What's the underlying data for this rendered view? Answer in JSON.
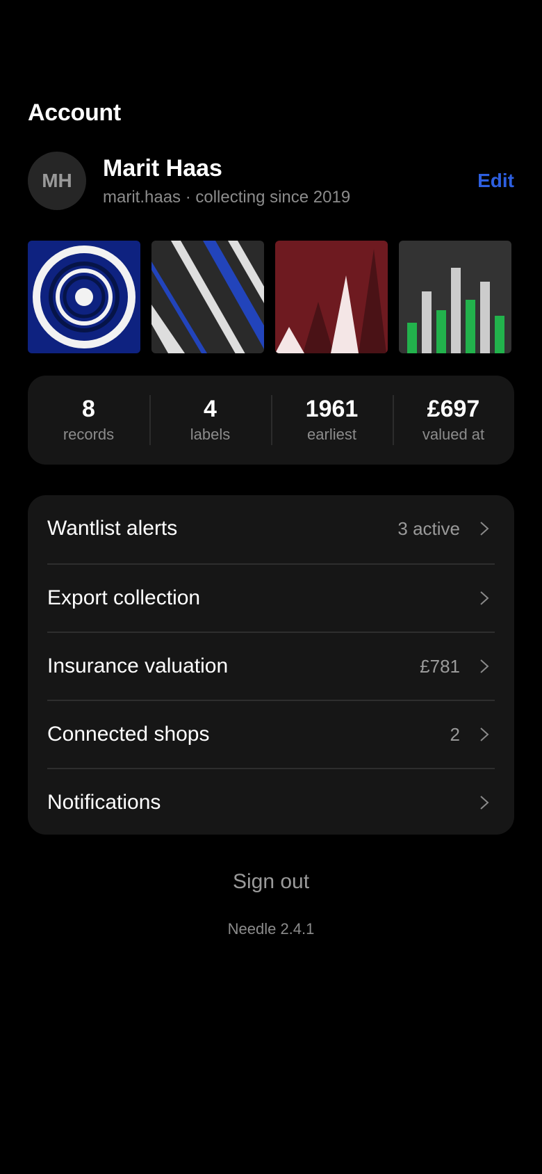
{
  "page": {
    "title": "Account"
  },
  "profile": {
    "initials": "MH",
    "name": "Marit Haas",
    "subtitle": "marit.haas · collecting since 2019",
    "edit_label": "Edit"
  },
  "colors": {
    "accent": "#2d5fe0",
    "background": "#000000",
    "card": "#161616"
  },
  "thumbnails": [
    {
      "name": "blue-rings-cover"
    },
    {
      "name": "diagonal-stripes-cover"
    },
    {
      "name": "red-peaks-cover"
    },
    {
      "name": "bars-cover"
    }
  ],
  "stats": [
    {
      "value": "8",
      "label": "records"
    },
    {
      "value": "4",
      "label": "labels"
    },
    {
      "value": "1961",
      "label": "earliest"
    },
    {
      "value": "£697",
      "label": "valued at"
    }
  ],
  "menu": [
    {
      "label": "Wantlist alerts",
      "value": "3 active",
      "icon": "chevron-right-icon"
    },
    {
      "label": "Export collection",
      "value": "",
      "icon": "chevron-right-icon"
    },
    {
      "label": "Insurance valuation",
      "value": "£781",
      "icon": "chevron-right-icon"
    },
    {
      "label": "Connected shops",
      "value": "2",
      "icon": "chevron-right-icon"
    },
    {
      "label": "Notifications",
      "value": "",
      "icon": "chevron-right-icon"
    }
  ],
  "footer": {
    "sign_out_label": "Sign out",
    "version": "Needle 2.4.1"
  }
}
